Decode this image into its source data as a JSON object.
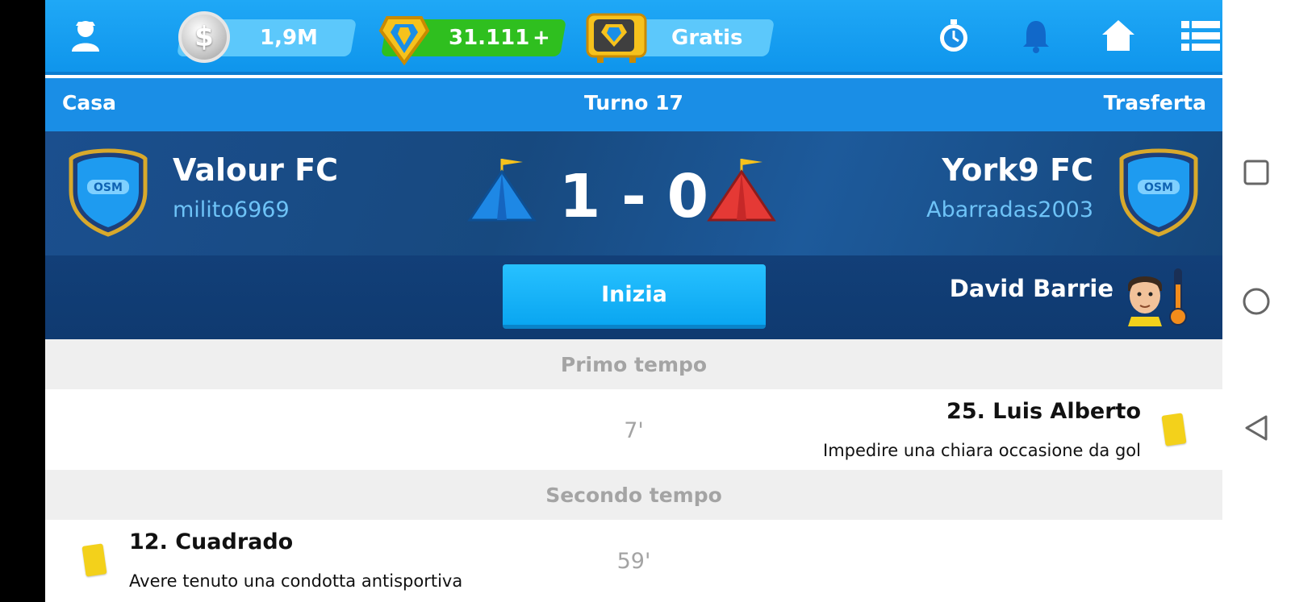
{
  "topbar": {
    "cash": "1,9M",
    "gold": "31.111",
    "gold_add": "+",
    "gratis": "Gratis",
    "icons": [
      "manager-icon",
      "coin-icon",
      "gold-badge-icon",
      "tv-icon",
      "stopwatch-icon",
      "bell-icon",
      "home-icon",
      "menu-icon"
    ]
  },
  "round": {
    "home_label": "Casa",
    "title": "Turno 17",
    "away_label": "Trasferta"
  },
  "match": {
    "home_team": "Valour FC",
    "home_user": "milito6969",
    "away_team": "York9 FC",
    "away_user": "Abarradas2003",
    "score": "1 - 0",
    "start_label": "Inizia",
    "referee": "David Barrie",
    "shield_text": "OSM",
    "colors": {
      "home_tent": "#1e88e5",
      "away_tent": "#e53935",
      "card": "#f3d11b"
    }
  },
  "events": {
    "first_half": "Primo tempo",
    "second_half": "Secondo tempo",
    "items": [
      {
        "minute": "7'",
        "player": "25. Luis Alberto",
        "description": "Impedire una chiara occasione da gol",
        "side": "away",
        "card": "yellow"
      },
      {
        "minute": "59'",
        "player": "12. Cuadrado",
        "description": "Avere tenuto una condotta antisportiva",
        "side": "home",
        "card": "yellow"
      }
    ]
  },
  "navbar": {
    "icons": [
      "recents-square-icon",
      "home-circle-icon",
      "back-triangle-icon"
    ]
  }
}
